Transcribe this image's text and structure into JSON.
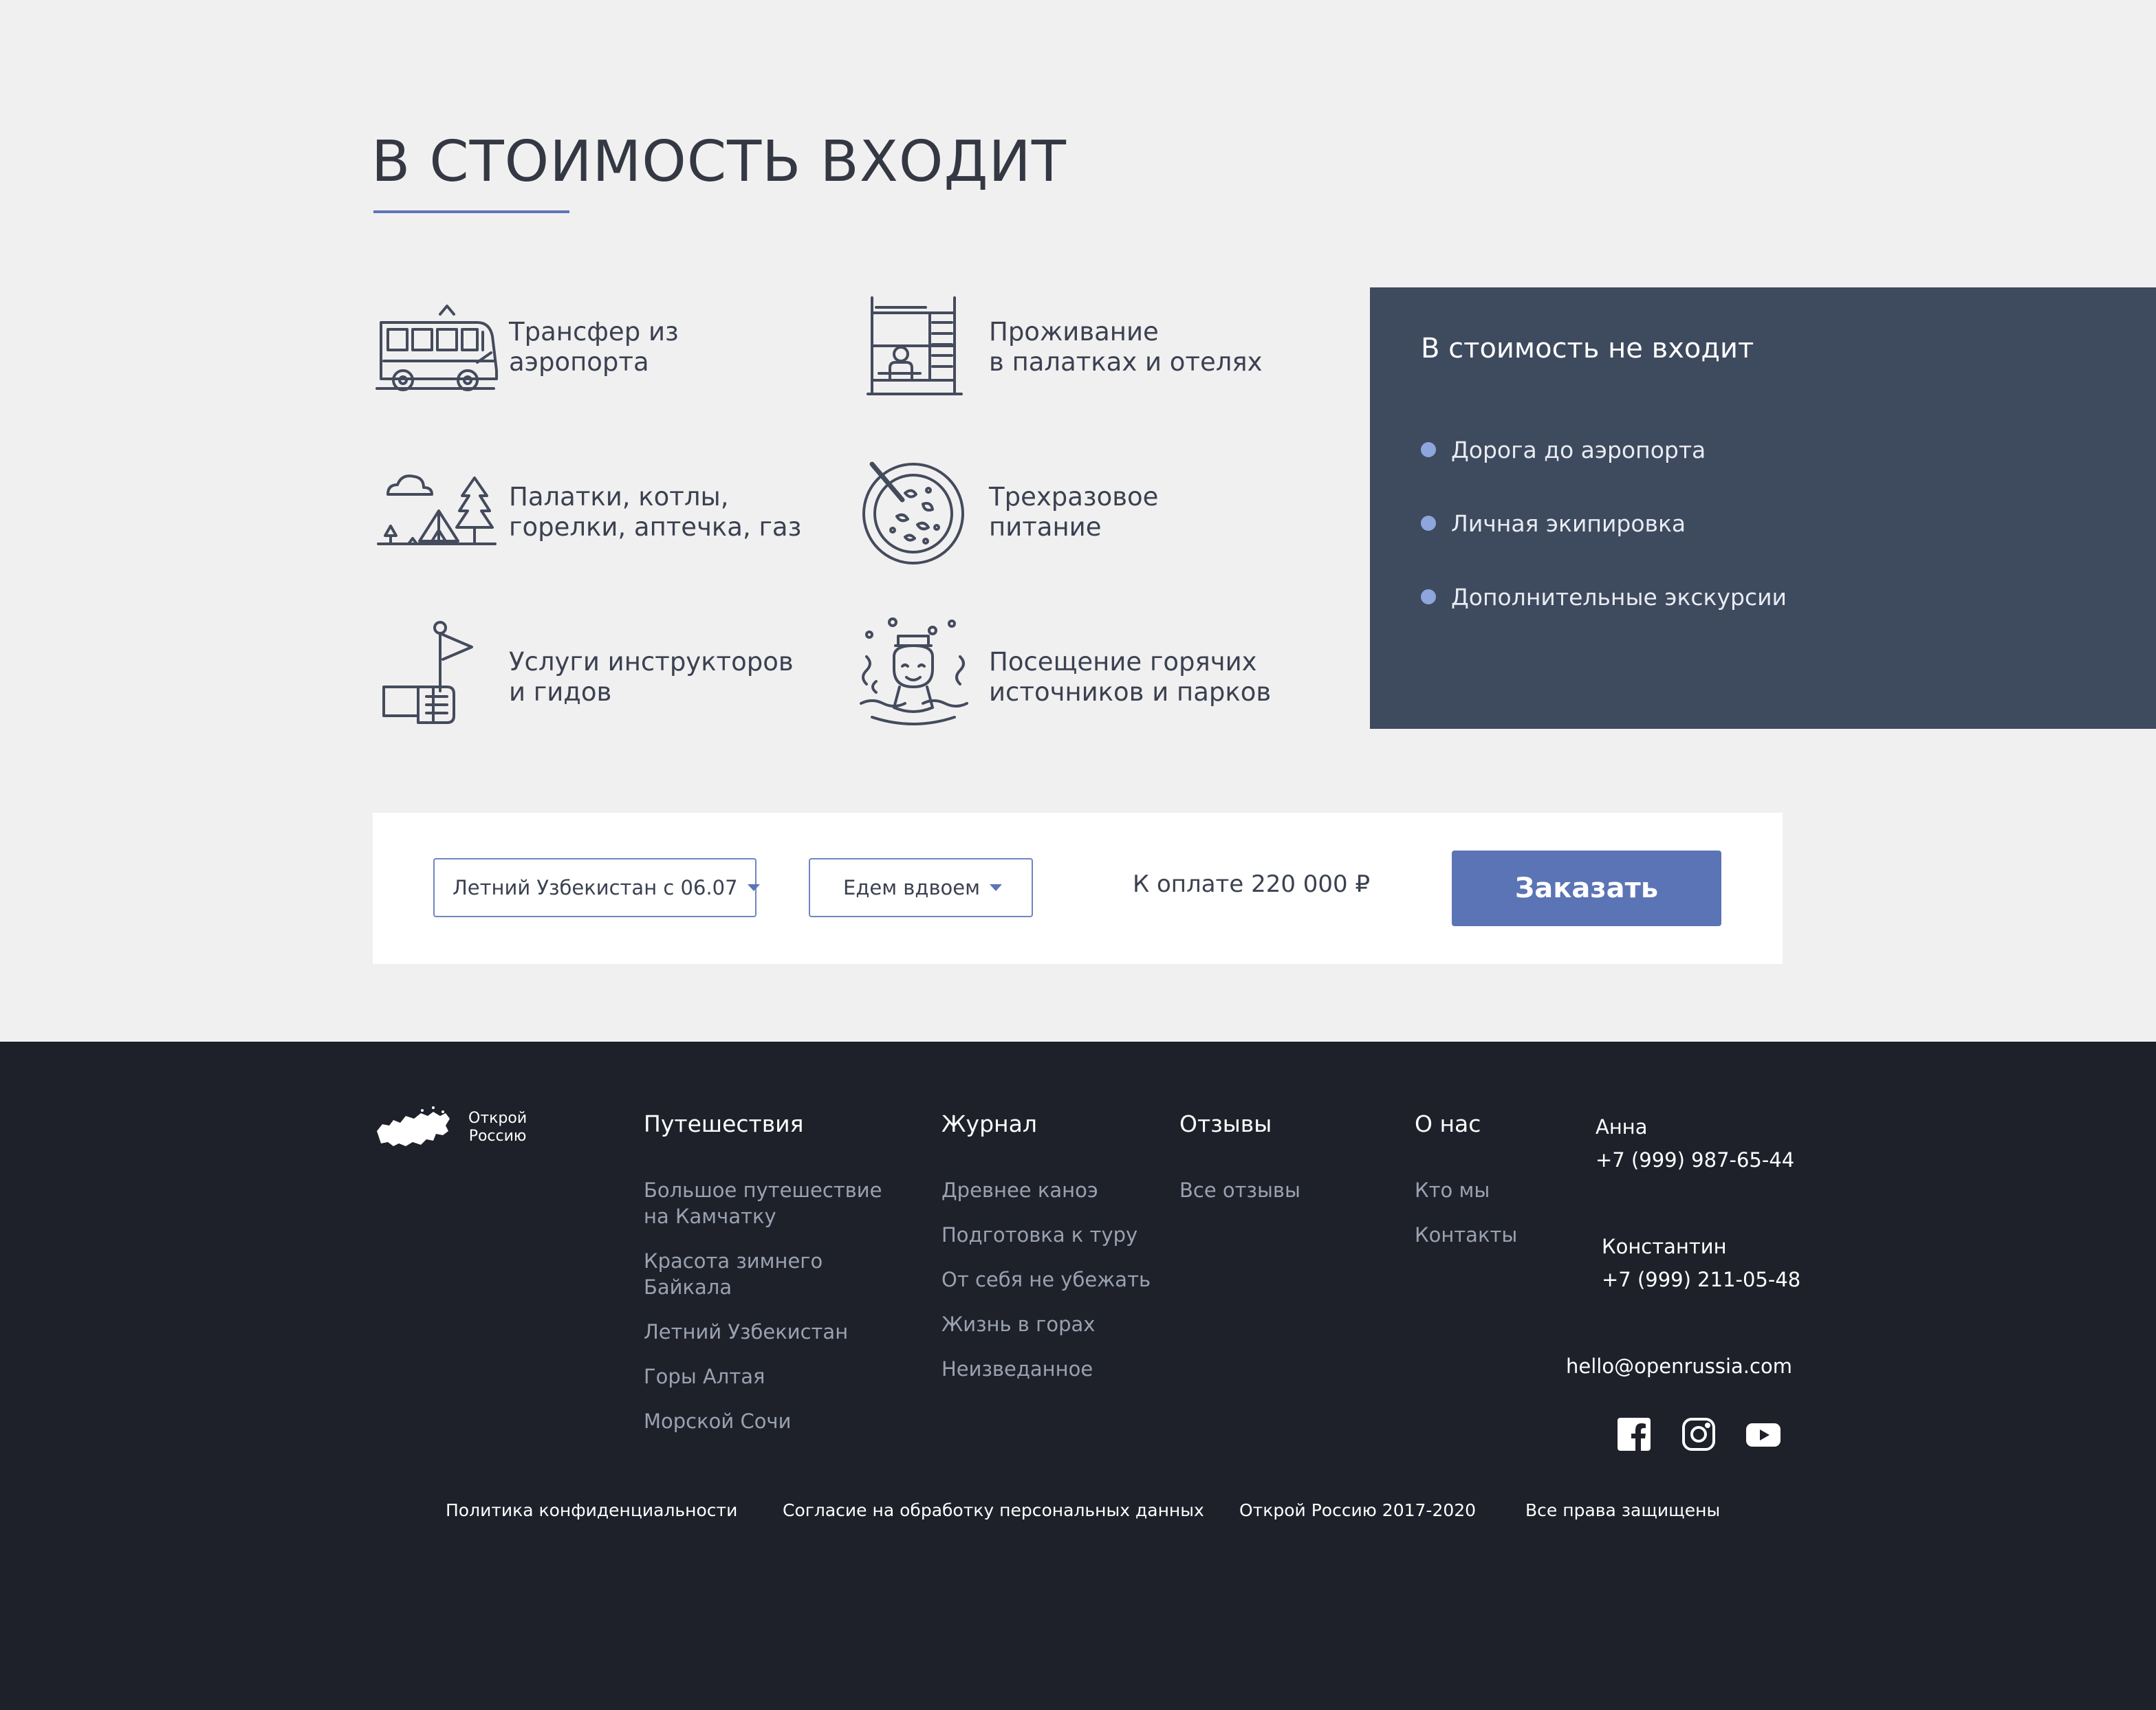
{
  "included": {
    "title": "В СТОИМОСТЬ ВХОДИТ",
    "items": [
      {
        "icon": "bus-icon",
        "line1": "Трансфер из",
        "line2": "аэропорта"
      },
      {
        "icon": "bunk-bed-icon",
        "line1": "Проживание",
        "line2": "в палатках и отелях"
      },
      {
        "icon": "camping-tent-icon",
        "line1": "Палатки, котлы,",
        "line2": "горелки, аптечка, газ"
      },
      {
        "icon": "meal-plate-icon",
        "line1": "Трехразовое",
        "line2": "питание"
      },
      {
        "icon": "flag-hand-icon",
        "line1": "Услуги инструкторов",
        "line2": "и гидов"
      },
      {
        "icon": "hot-spring-icon",
        "line1": "Посещение горячих",
        "line2": "источников и парков"
      }
    ]
  },
  "excluded": {
    "title": "В стоимость не входит",
    "items": [
      "Дорога до аэропорта",
      "Личная экипировка",
      "Дополнительные экскурсии"
    ]
  },
  "order": {
    "tour_select": "Летний Узбекистан с 06.07",
    "people_select": "Едем вдвоем",
    "price_label": "К оплате 220 000 ₽",
    "button": "Заказать"
  },
  "footer": {
    "logo": {
      "line1": "Открой",
      "line2": "Россию"
    },
    "columns": [
      {
        "title": "Путешествия",
        "links": [
          {
            "line1": "Большое путешествие",
            "line2": "на Камчатку"
          },
          {
            "line1": "Красота зимнего",
            "line2": "Байкала"
          },
          {
            "line1": "Летний Узбекистан",
            "line2": ""
          },
          {
            "line1": "Горы Алтая",
            "line2": ""
          },
          {
            "line1": "Морской Сочи",
            "line2": ""
          }
        ]
      },
      {
        "title": "Журнал",
        "links": [
          "Древнее каноэ",
          "Подготовка к туру",
          "От себя не убежать",
          "Жизнь в горах",
          "Неизведанное"
        ]
      },
      {
        "title": "Отзывы",
        "links": [
          "Все отзывы"
        ]
      },
      {
        "title": "О нас",
        "links": [
          "Кто мы",
          "Контакты"
        ]
      }
    ],
    "contacts": [
      {
        "name": "Анна",
        "phone": "+7 (999) 987-65-44"
      },
      {
        "name": "Константин",
        "phone": "+7 (999) 211-05-48"
      }
    ],
    "email": "hello@openrussia.com",
    "socials": [
      "facebook-icon",
      "instagram-icon",
      "youtube-icon"
    ],
    "bottom": [
      "Политика конфиденциальности",
      "Согласие на обработку персональных данных",
      "Открой Россию 2017-2020",
      "Все права защищены"
    ]
  },
  "colors": {
    "background": "#f1f0f1",
    "accent": "#5b74b5",
    "panel": "#3e4a5e",
    "footer": "#1e212a"
  }
}
